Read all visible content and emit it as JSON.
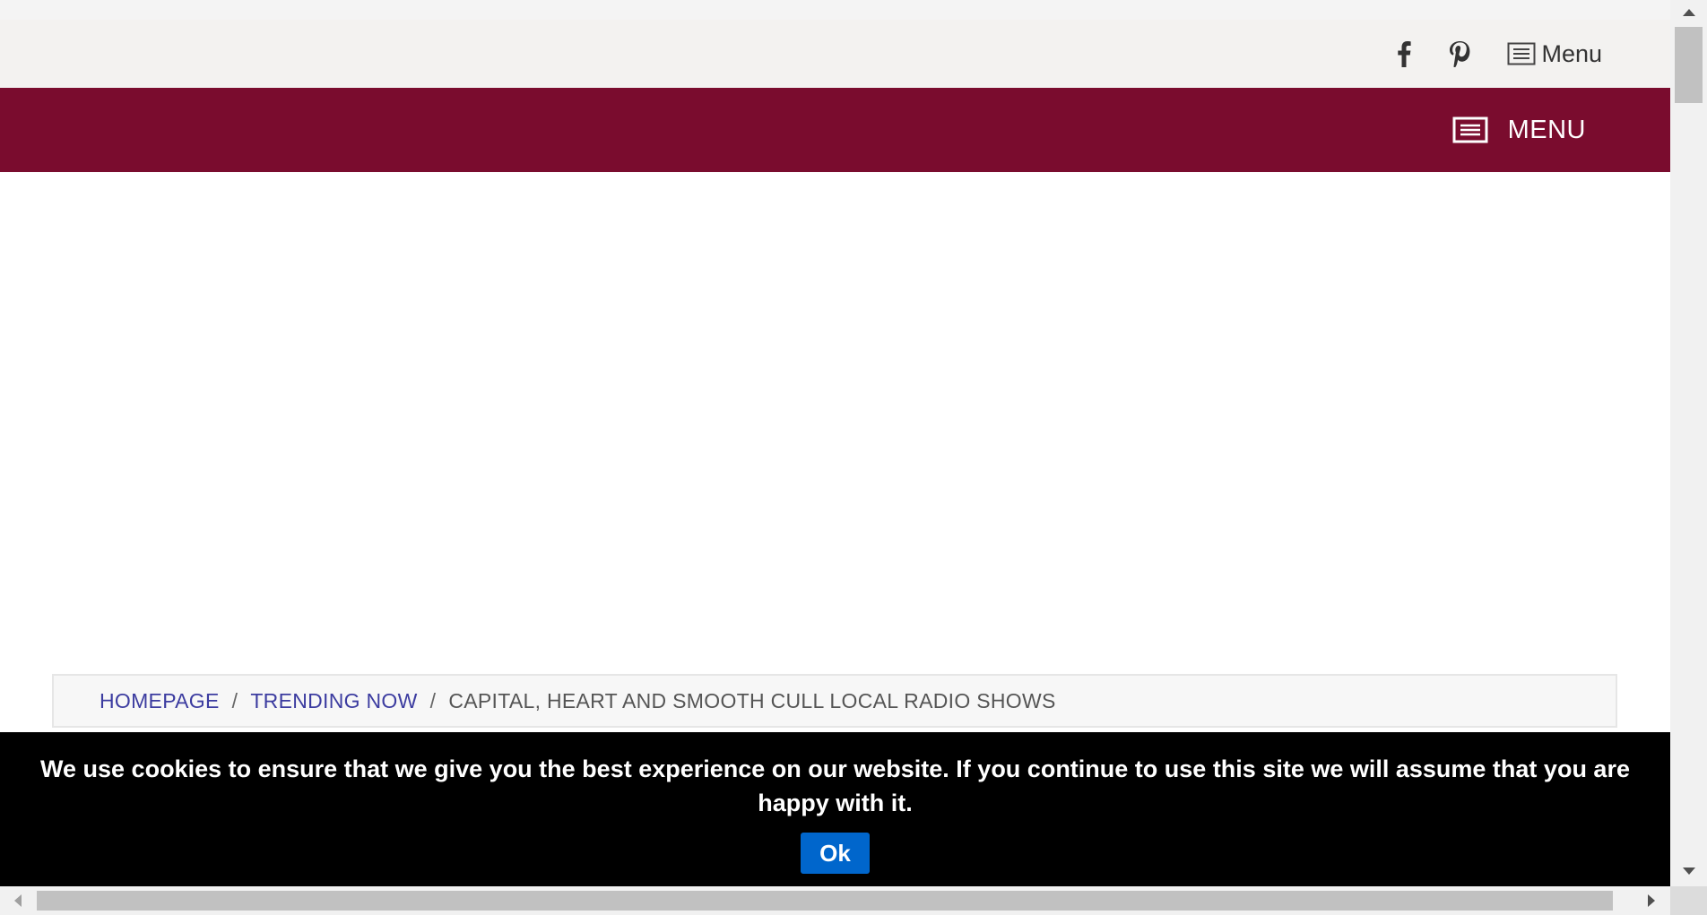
{
  "topbar": {
    "facebook_icon": "facebook-icon",
    "pinterest_icon": "pinterest-icon",
    "menu_icon": "menu-list-icon",
    "menu_label": "Menu"
  },
  "navbar": {
    "background": "#7a0c2e",
    "menu_icon": "menu-list-icon",
    "menu_label": "MENU"
  },
  "breadcrumb": {
    "items": [
      {
        "label": "HOMEPAGE"
      },
      {
        "label": "TRENDING NOW"
      }
    ],
    "separator": "/",
    "current": "CAPITAL, HEART AND SMOOTH CULL LOCAL RADIO SHOWS",
    "link_color": "#3c3ca0"
  },
  "cookie_notice": {
    "message": "We use cookies to ensure that we give you the best experience on our website. If you continue to use this site we will assume that you are happy with it.",
    "ok_label": "Ok",
    "button_color": "#0066cc"
  }
}
